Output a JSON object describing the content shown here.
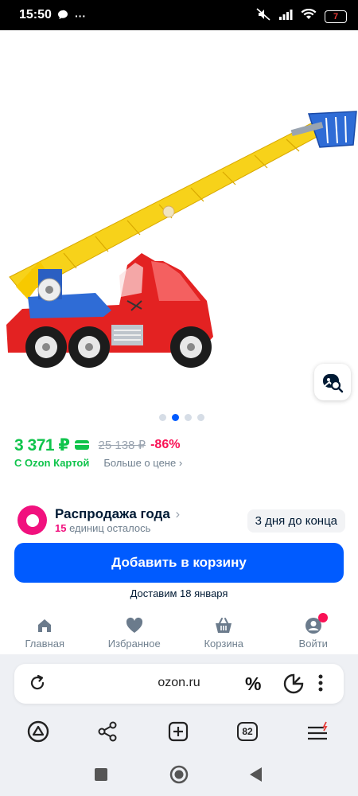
{
  "status_bar": {
    "time": "15:50",
    "battery": "7"
  },
  "gallery": {
    "image_alt": "fire truck toy",
    "dots": 4,
    "active_dot": 1
  },
  "price": {
    "current": "3 371 ₽",
    "old": "25 138 ₽",
    "discount": "-86%",
    "card_text": "С Ozon Картой",
    "more_link": "Больше о цене"
  },
  "sale": {
    "title": "Распродажа года",
    "units_count": "15",
    "units_text": "единиц осталось",
    "days_left": "3 дня до конца"
  },
  "cart_button": {
    "label": "Добавить в корзину"
  },
  "delivery": {
    "text": "Доставим 18 января"
  },
  "bottom_nav": [
    {
      "label": "Главная",
      "icon": "home-icon"
    },
    {
      "label": "Избранное",
      "icon": "heart-icon"
    },
    {
      "label": "Корзина",
      "icon": "cart-icon"
    },
    {
      "label": "Войти",
      "icon": "profile-icon"
    }
  ],
  "browser": {
    "url": "ozon.ru",
    "tabs_count": "82"
  },
  "colors": {
    "brand_blue": "#005bff",
    "price_green": "#10c44c",
    "discount_pink": "#f91155",
    "sale_pink": "#f1117e"
  }
}
